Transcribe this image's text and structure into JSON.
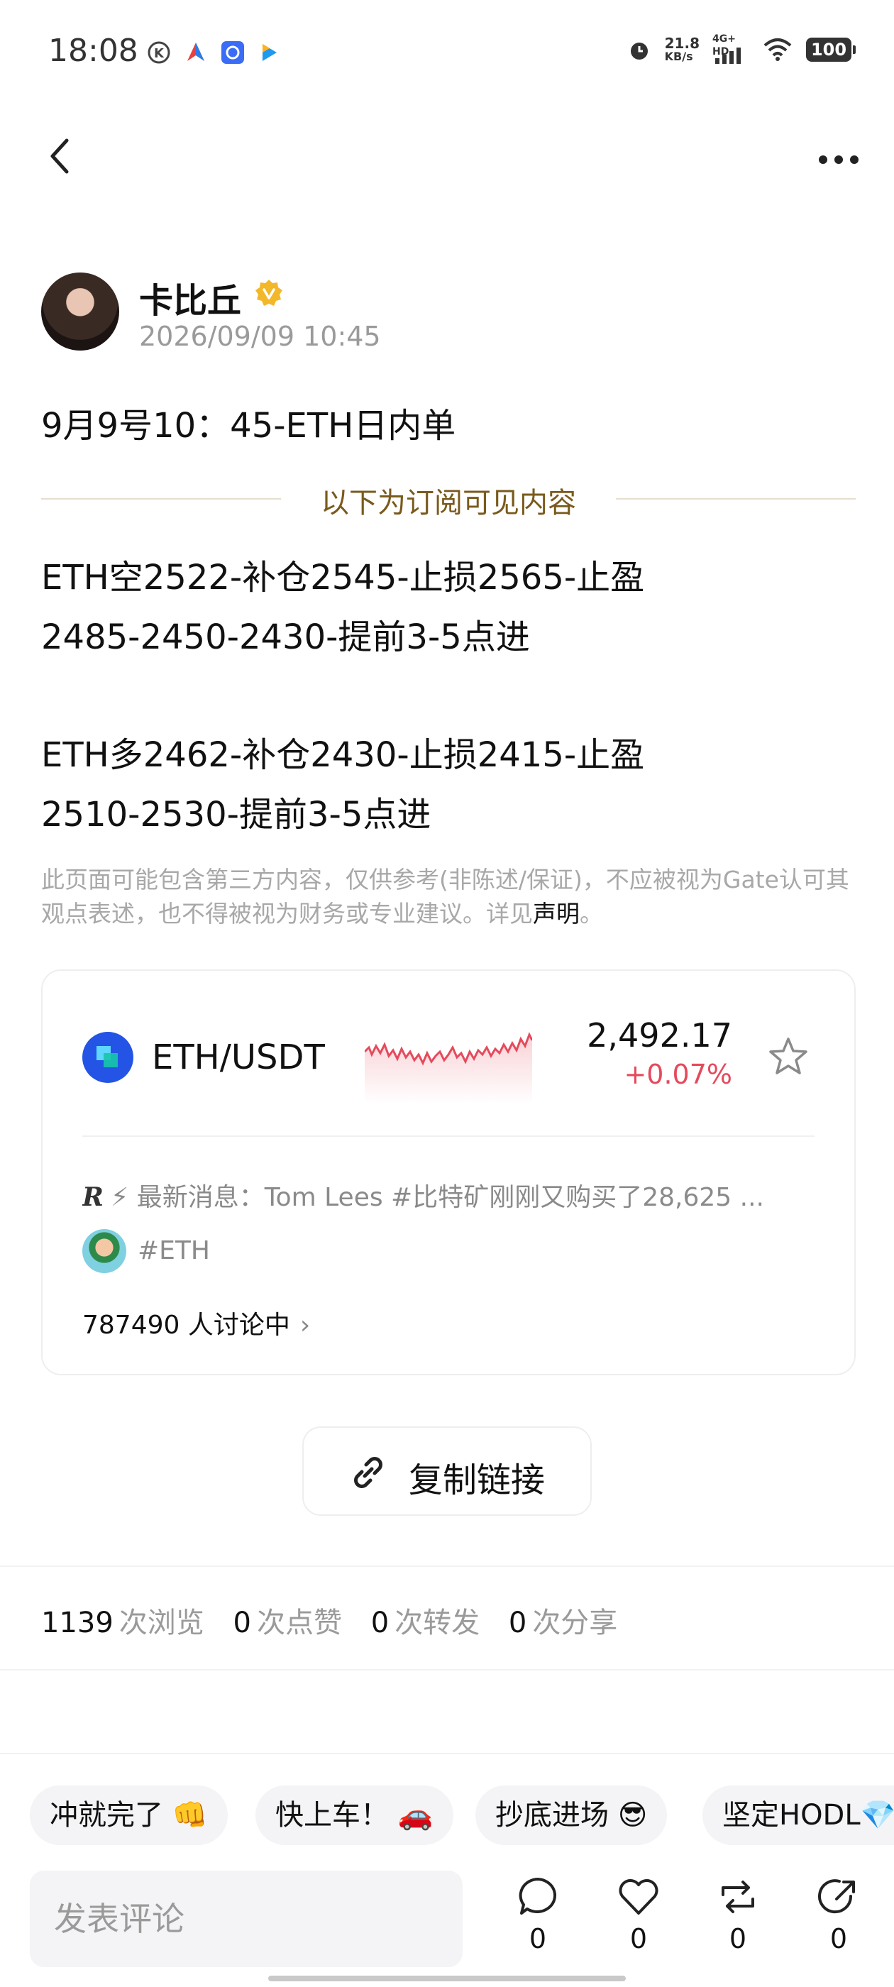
{
  "status_bar": {
    "time": "18:08",
    "net_speed_value": "21.8",
    "net_speed_unit": "KB/s",
    "network": "4G+ HD",
    "battery": "100"
  },
  "author": {
    "name": "卡比丘",
    "time": "2026/09/09 10:45"
  },
  "post": {
    "title": "9月9号10：45-ETH日内单",
    "subscriber_divider": "以下为订阅可见内容",
    "lines": [
      "ETH空2522-补仓2545-止损2565-止盈",
      "2485-2450-2430-提前3-5点进",
      "ETH多2462-补仓2430-止损2415-止盈",
      "2510-2530-提前3-5点进"
    ],
    "disclaimer": "此页面可能包含第三方内容，仅供参考(非陈述/保证)，不应被视为Gate认可其观点表述，也不得被视为财务或专业建议。详见",
    "disclaimer_link": "声明",
    "disclaimer_end": "。"
  },
  "market_card": {
    "pair": "ETH/USDT",
    "price": "2,492.17",
    "change": "+0.07%",
    "news": "⚡ 最新消息：Tom Lees #比特矿刚刚又购买了28,625 ...",
    "tag": "#ETH",
    "discussing": "787490 人讨论中",
    "chevron": "›",
    "colors": {
      "down": "#e54a5c",
      "coin": "#2354e6"
    }
  },
  "copy_link": {
    "label": "复制链接"
  },
  "stats": {
    "views_count": "1139",
    "views_label": "次浏览",
    "likes_count": "0",
    "likes_label": "次点赞",
    "reposts_count": "0",
    "reposts_label": "次转发",
    "shares_count": "0",
    "shares_label": "次分享"
  },
  "quick_replies": [
    "冲就完了 👊",
    "快上车！ 🚗",
    "抄底进场 😎",
    "坚定HODL💎"
  ],
  "comment_bar": {
    "placeholder": "发表评论",
    "comment_count": "0",
    "like_count": "0",
    "repost_count": "0",
    "share_count": "0"
  }
}
